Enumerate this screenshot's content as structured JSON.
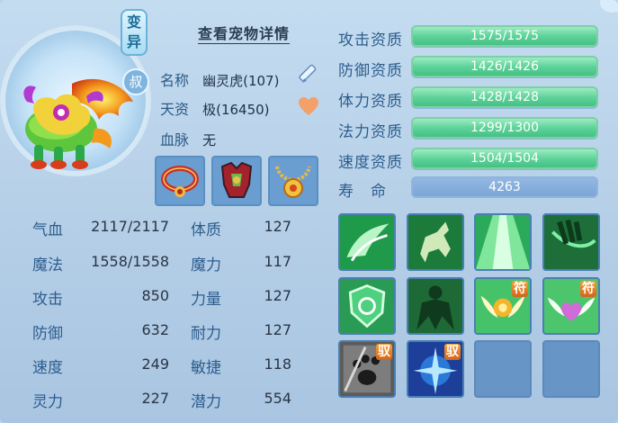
{
  "header": {
    "detail_link": "查看宠物详情"
  },
  "pet": {
    "badge_change": "变异",
    "badge_tier": "叔",
    "name_label": "名称",
    "name_value": "幽灵虎(107)",
    "talent_label": "天资",
    "talent_value": "极(16450)",
    "bloodline_label": "血脉",
    "bloodline_value": "无"
  },
  "icons": {
    "edit": "pencil-edit-icon",
    "favorite": "heart-icon",
    "equip": [
      "red-collar-icon",
      "red-armor-icon",
      "gold-necklace-icon"
    ]
  },
  "attributes": [
    {
      "label": "气血",
      "value": "2117/2117",
      "label2": "体质",
      "value2": "127"
    },
    {
      "label": "魔法",
      "value": "1558/1558",
      "label2": "魔力",
      "value2": "117"
    },
    {
      "label": "攻击",
      "value": "850",
      "label2": "力量",
      "value2": "127"
    },
    {
      "label": "防御",
      "value": "632",
      "label2": "耐力",
      "value2": "127"
    },
    {
      "label": "速度",
      "value": "249",
      "label2": "敏捷",
      "value2": "118"
    },
    {
      "label": "灵力",
      "value": "227",
      "label2": "潜力",
      "value2": "554"
    }
  ],
  "aptitudes": [
    {
      "label": "攻击资质",
      "value": "1575/1575"
    },
    {
      "label": "防御资质",
      "value": "1426/1426"
    },
    {
      "label": "体力资质",
      "value": "1428/1428"
    },
    {
      "label": "法力资质",
      "value": "1299/1300"
    },
    {
      "label": "速度资质",
      "value": "1504/1504"
    }
  ],
  "lifespan": {
    "label": "寿　命",
    "value": "4263"
  },
  "skills": [
    {
      "icon": "wing-swoosh-icon",
      "tag": ""
    },
    {
      "icon": "horse-rider-icon",
      "tag": ""
    },
    {
      "icon": "light-beam-icon",
      "tag": ""
    },
    {
      "icon": "claw-slash-icon",
      "tag": ""
    },
    {
      "icon": "shield-spiral-icon",
      "tag": ""
    },
    {
      "icon": "giant-figure-icon",
      "tag": ""
    },
    {
      "icon": "golden-orb-wings-icon",
      "tag": "符"
    },
    {
      "icon": "purple-heart-wings-icon",
      "tag": "符"
    },
    {
      "icon": "paw-strike-icon",
      "tag": "驭"
    },
    {
      "icon": "ice-strike-icon",
      "tag": "驭"
    },
    {
      "icon": "empty-slot",
      "tag": ""
    },
    {
      "icon": "empty-slot",
      "tag": ""
    }
  ],
  "colors": {
    "bar_green": "#5fd39a",
    "panel_blue": "#b9d3ea",
    "label_blue": "#2d5d8d"
  }
}
